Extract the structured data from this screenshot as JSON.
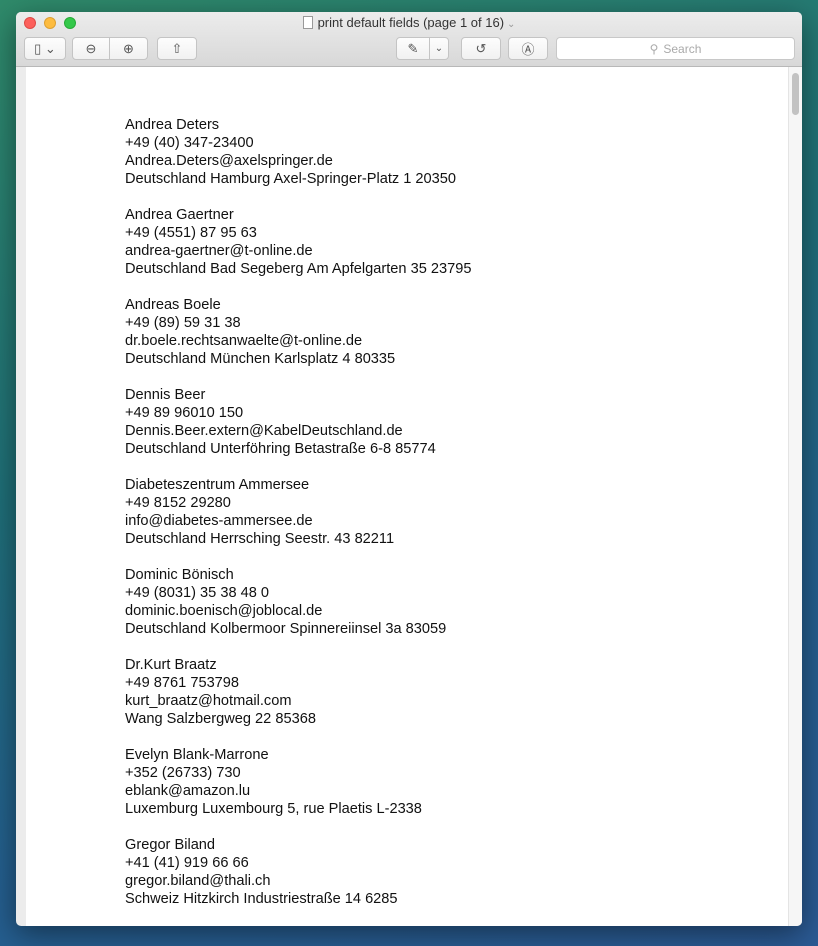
{
  "window": {
    "title": "print default fields (page 1 of 16)"
  },
  "toolbar": {
    "search_placeholder": "Search"
  },
  "entries": [
    {
      "name": "Andrea Deters",
      "phone": "+49 (40) 347-23400",
      "email": "Andrea.Deters@axelspringer.de",
      "address": "Deutschland Hamburg Axel-Springer-Platz 1 20350"
    },
    {
      "name": "Andrea Gaertner",
      "phone": "+49 (4551) 87 95 63",
      "email": "andrea-gaertner@t-online.de",
      "address": "Deutschland Bad Segeberg Am Apfelgarten 35 23795"
    },
    {
      "name": "Andreas Boele",
      "phone": "+49 (89) 59 31 38",
      "email": "dr.boele.rechtsanwaelte@t-online.de",
      "address": "Deutschland München Karlsplatz 4 80335"
    },
    {
      "name": "Dennis Beer",
      "phone": "+49 89 96010 150",
      "email": "Dennis.Beer.extern@KabelDeutschland.de",
      "address": "Deutschland Unterföhring Betastraße 6-8 85774"
    },
    {
      "name": "Diabeteszentrum Ammersee",
      "phone": "+49 8152 29280",
      "email": "info@diabetes-ammersee.de",
      "address": "Deutschland Herrsching Seestr. 43 82211"
    },
    {
      "name": "Dominic Bönisch",
      "phone": "+49 (8031) 35 38 48 0",
      "email": "dominic.boenisch@joblocal.de",
      "address": "Deutschland Kolbermoor Spinnereiinsel 3a 83059"
    },
    {
      "name": "Dr.Kurt Braatz",
      "phone": "+49 8761 753798",
      "email": "kurt_braatz@hotmail.com",
      "address": "Wang Salzbergweg 22 85368"
    },
    {
      "name": "Evelyn Blank-Marrone",
      "phone": "+352 (26733) 730",
      "email": "eblank@amazon.lu",
      "address": "Luxemburg Luxembourg 5, rue Plaetis L-2338"
    },
    {
      "name": "Gregor Biland",
      "phone": "+41 (41) 919 66 66",
      "email": "gregor.biland@thali.ch",
      "address": "Schweiz Hitzkirch Industriestraße 14 6285"
    }
  ]
}
